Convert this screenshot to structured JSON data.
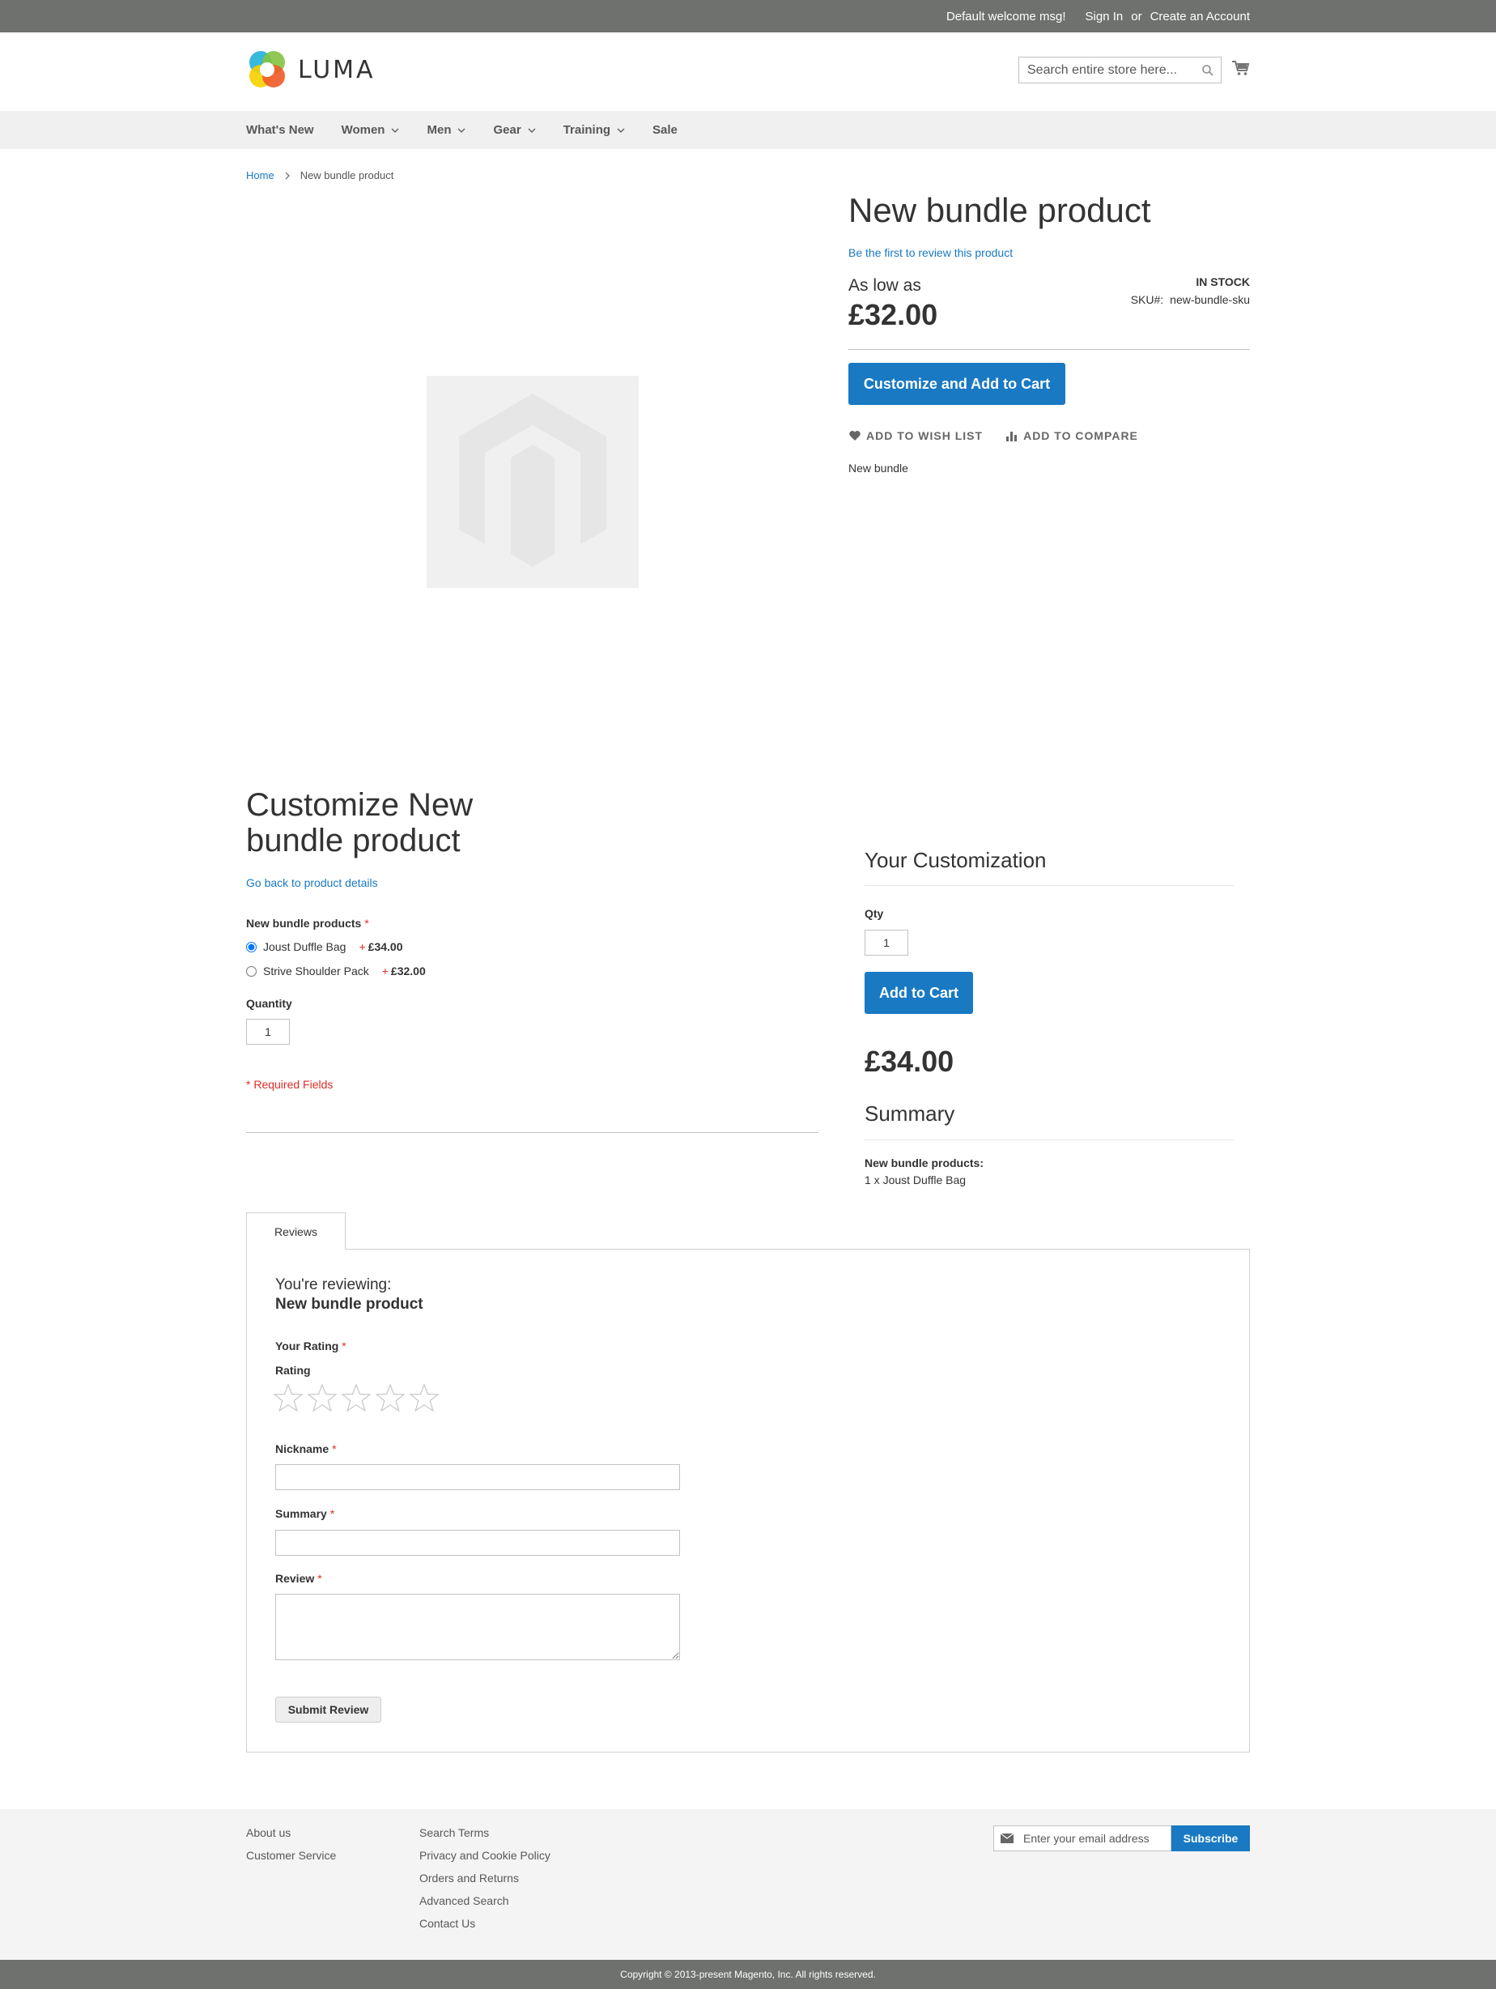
{
  "top_links": {
    "welcome": "Default welcome msg!",
    "sign_in": "Sign In",
    "or": "or",
    "create_account": "Create an Account"
  },
  "header": {
    "logo_text": "LUMA",
    "search_placeholder": "Search entire store here...",
    "cart_icon": "cart-icon",
    "search_icon": "search-icon"
  },
  "nav": {
    "items": [
      {
        "label": "What's New",
        "has_dropdown": false
      },
      {
        "label": "Women",
        "has_dropdown": true
      },
      {
        "label": "Men",
        "has_dropdown": true
      },
      {
        "label": "Gear",
        "has_dropdown": true
      },
      {
        "label": "Training",
        "has_dropdown": true
      },
      {
        "label": "Sale",
        "has_dropdown": false
      }
    ]
  },
  "breadcrumb": {
    "home": "Home",
    "separator": ">",
    "current": "New bundle product"
  },
  "product": {
    "title": "New bundle product",
    "review_link": "Be the first to review this product",
    "as_low_as": "As low as",
    "price": "£32.00",
    "stock": "In stock",
    "sku_label": "SKU#:",
    "sku_value": "new-bundle-sku",
    "customize_button": "Customize and Add to Cart",
    "wishlist": "Add to Wish List",
    "compare": "Add to Compare",
    "short_description": "New bundle"
  },
  "customize": {
    "title": "Customize New bundle product",
    "back_link": "Go back to product details",
    "option_label": "New bundle products",
    "required_mark": "*",
    "options": [
      {
        "label": "Joust Duffle Bag",
        "plus": "+",
        "price": "£34.00",
        "selected": true
      },
      {
        "label": "Strive Shoulder Pack",
        "plus": "+",
        "price": "£32.00",
        "selected": false
      }
    ],
    "quantity_label": "Quantity",
    "quantity_value": "1",
    "required_fields": "* Required Fields"
  },
  "summary": {
    "your_customization": "Your Customization",
    "qty_label": "Qty",
    "qty_value": "1",
    "add_to_cart": "Add to Cart",
    "price": "£34.00",
    "summary_title": "Summary",
    "bundle_label": "New bundle products:",
    "bundle_item": "1 x Joust Duffle Bag"
  },
  "reviews": {
    "tab_label": "Reviews",
    "reviewing": "You're reviewing:",
    "product_name": "New bundle product",
    "your_rating": "Your Rating",
    "rating_label": "Rating",
    "rating_value": 0,
    "rating_max": 5,
    "nickname_label": "Nickname",
    "summary_label": "Summary",
    "review_label": "Review",
    "nickname_value": "",
    "summary_value": "",
    "review_value": "",
    "submit": "Submit Review"
  },
  "footer": {
    "col1": [
      "About us",
      "Customer Service"
    ],
    "col2": [
      "Search Terms",
      "Privacy and Cookie Policy",
      "Orders and Returns",
      "Advanced Search",
      "Contact Us"
    ],
    "newsletter_placeholder": "Enter your email address",
    "subscribe": "Subscribe",
    "copyright": "Copyright © 2013-present Magento, Inc. All rights reserved."
  },
  "colors": {
    "accent": "#1979c3",
    "required": "#e02b27",
    "top_bar": "#6e716e",
    "nav_bg": "#f0f0f0"
  }
}
